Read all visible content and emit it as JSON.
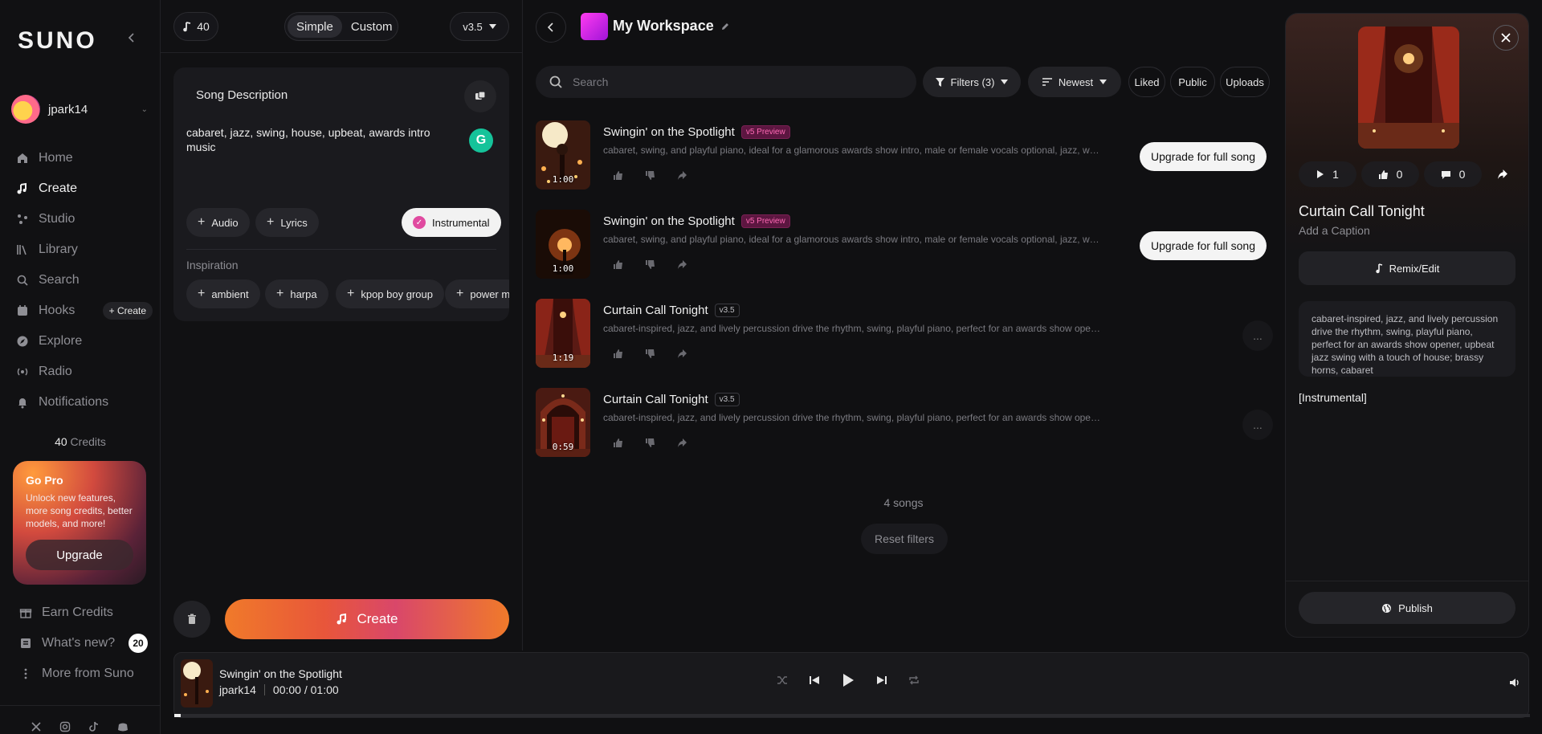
{
  "sidebar": {
    "logo": "SUNO",
    "user": "jpark14",
    "nav": [
      {
        "label": "Home",
        "icon": "home-icon"
      },
      {
        "label": "Create",
        "icon": "create-icon",
        "active": true
      },
      {
        "label": "Studio",
        "icon": "studio-icon"
      },
      {
        "label": "Library",
        "icon": "library-icon"
      },
      {
        "label": "Search",
        "icon": "search-icon"
      },
      {
        "label": "Hooks",
        "icon": "hooks-icon",
        "pill": "+ Create"
      },
      {
        "label": "Explore",
        "icon": "explore-icon"
      },
      {
        "label": "Radio",
        "icon": "radio-icon"
      },
      {
        "label": "Notifications",
        "icon": "bell-icon"
      }
    ],
    "credits_count": "40",
    "credits_label": "Credits",
    "gopro": {
      "title": "Go Pro",
      "text": "Unlock new features, more song credits, better models, and more!",
      "button": "Upgrade"
    },
    "bottom": [
      {
        "label": "Earn Credits",
        "icon": "gift-icon"
      },
      {
        "label": "What's new?",
        "icon": "news-icon",
        "badge": "20"
      },
      {
        "label": "More from Suno",
        "icon": "more-vertical-icon"
      }
    ]
  },
  "create": {
    "credits": "40",
    "modes": [
      "Simple",
      "Custom"
    ],
    "active_mode": "Simple",
    "version": "v3.5",
    "desc_label": "Song Description",
    "desc_text": "cabaret, jazz, swing, house, upbeat, awards intro music",
    "chips": [
      "Audio",
      "Lyrics"
    ],
    "instrumental": "Instrumental",
    "inspiration_label": "Inspiration",
    "inspiration": [
      "ambient",
      "harpa",
      "kpop boy group",
      "power m"
    ],
    "create_button": "Create"
  },
  "workspace": {
    "title": "My Workspace",
    "search_placeholder": "Search",
    "filters": "Filters (3)",
    "sort": "Newest",
    "liked": "Liked",
    "public": "Public",
    "uploads": "Uploads",
    "songs": [
      {
        "title": "Swingin' on the Spotlight",
        "tag": "v5 Preview",
        "preview": true,
        "desc": "cabaret, swing, and playful piano, ideal for a glamorous awards show intro, male or female vocals optional, jazz, walking b...",
        "duration": "1:00",
        "action": "Upgrade for full song"
      },
      {
        "title": "Swingin' on the Spotlight",
        "tag": "v5 Preview",
        "preview": true,
        "desc": "cabaret, swing, and playful piano, ideal for a glamorous awards show intro, male or female vocals optional, jazz, walking b...",
        "duration": "1:00",
        "action": "Upgrade for full song"
      },
      {
        "title": "Curtain Call Tonight",
        "tag": "v3.5",
        "preview": false,
        "desc": "cabaret-inspired, jazz, and lively percussion drive the rhythm, swing, playful piano, perfect for an awards show opener, ...",
        "duration": "1:19",
        "action": "..."
      },
      {
        "title": "Curtain Call Tonight",
        "tag": "v3.5",
        "preview": false,
        "desc": "cabaret-inspired, jazz, and lively percussion drive the rhythm, swing, playful piano, perfect for an awards show opener, ...",
        "duration": "0:59",
        "action": "..."
      }
    ],
    "song_count": "4 songs",
    "reset": "Reset filters"
  },
  "detail": {
    "plays": "1",
    "likes": "0",
    "comments": "0",
    "title": "Curtain Call Tonight",
    "caption": "Add a Caption",
    "remix": "Remix/Edit",
    "style": "cabaret-inspired, jazz, and lively percussion drive the rhythm, swing, playful piano, perfect for an awards show opener, upbeat jazz swing with a touch of house; brassy horns, cabaret",
    "lyrics": "[Instrumental]",
    "publish": "Publish"
  },
  "player": {
    "title": "Swingin' on the Spotlight",
    "artist": "jpark14",
    "time": "00:00 /  01:00",
    "progress": 0.005
  }
}
